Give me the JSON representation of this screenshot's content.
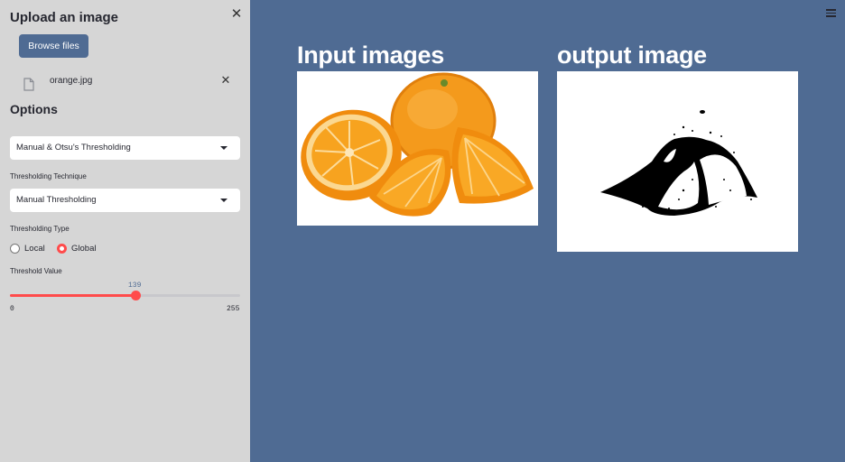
{
  "sidebar": {
    "upload_title": "Upload an image",
    "browse_label": "Browse files",
    "file_name": "orange.jpg",
    "options_title": "Options",
    "mode_select": "Manual & Otsu's Thresholding",
    "technique_label": "Thresholding Technique",
    "technique_select": "Manual Thresholding",
    "type_label": "Thresholding Type",
    "type_options": [
      {
        "label": "Local",
        "checked": false
      },
      {
        "label": "Global",
        "checked": true
      }
    ],
    "threshold_label": "Threshold Value",
    "slider": {
      "value": "139",
      "min": "0",
      "max": "255"
    }
  },
  "main": {
    "input_heading": "Input images",
    "output_heading": "output image"
  },
  "colors": {
    "accent": "#ff4b4b",
    "button": "#4f6b93",
    "main_bg": "#4f6b93",
    "sidebar_bg": "#d6d6d6",
    "orange": "#f7941d"
  },
  "icons": [
    "close-icon",
    "file-icon",
    "chevron-down-icon",
    "hamburger-menu-icon"
  ]
}
